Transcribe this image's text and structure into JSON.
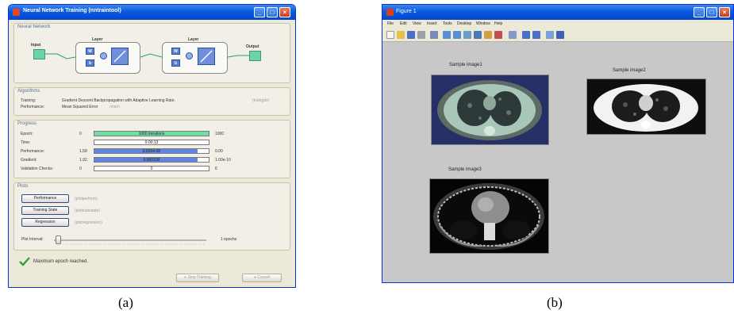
{
  "panel_a": {
    "caption": "(a)",
    "window_title": "Neural Network Training (nntraintool)",
    "neural_network": {
      "group_label": "Neural Network",
      "input_label": "Input",
      "output_label": "Output",
      "layer_label": "Layer",
      "w_label": "W",
      "b_label": "b"
    },
    "algorithms": {
      "group_label": "Algorithms",
      "rows": [
        {
          "label": "Training:",
          "value": "Gradient Descent Backpropagation with Adaptive Learning Rate.",
          "link": "(traingdx)"
        },
        {
          "label": "Performance:",
          "value": "Mean Squared Error",
          "link": "(mse)"
        }
      ]
    },
    "progress": {
      "group_label": "Progress",
      "rows": [
        {
          "label": "Epoch:",
          "start": "0",
          "bar_text": "1000 iterations",
          "end": "1000",
          "fraction": 1.0,
          "color": "#6ee0a4"
        },
        {
          "label": "Time:",
          "start": "",
          "bar_text": "0:00:13",
          "end": "",
          "fraction": 0.0,
          "color": "#6ee0a4"
        },
        {
          "label": "Performance:",
          "start": "1.58",
          "bar_text": "0.0264-05",
          "end": "0.00",
          "fraction": 0.9,
          "color": "#5f86e3"
        },
        {
          "label": "Gradient:",
          "start": "1.92",
          "bar_text": "0.000109",
          "end": "1.00e-10",
          "fraction": 0.9,
          "color": "#5f86e3"
        },
        {
          "label": "Validation Checks:",
          "start": "0",
          "bar_text": "0",
          "end": "6",
          "fraction": 0.0,
          "color": "#6ee0a4"
        }
      ]
    },
    "plots": {
      "group_label": "Plots",
      "buttons": [
        {
          "label": "Performance",
          "link": "(plotperform)"
        },
        {
          "label": "Training State",
          "link": "(plottrainstate)"
        },
        {
          "label": "Regression",
          "link": "(plotregression)"
        }
      ],
      "plot_interval_label": "Plot Interval:",
      "plot_interval_value": "1 epochs"
    },
    "status_text": "Maximum epoch reached.",
    "stop_training_label": "Stop Training",
    "cancel_label": "Cancel"
  },
  "panel_b": {
    "caption": "(b)",
    "window_title": "Figure 1",
    "menu": [
      "File",
      "Edit",
      "View",
      "Insert",
      "Tools",
      "Desktop",
      "Window",
      "Help"
    ],
    "images": [
      {
        "title": "Sample image1"
      },
      {
        "title": "Sample image2"
      },
      {
        "title": "Sample image3"
      }
    ]
  },
  "colors": {
    "xp_title_blue": "#0a5be0",
    "xp_face": "#ece9d8",
    "nn_green": "#6ed2a8",
    "nn_blue": "#5a7ed8",
    "figure_bg": "#c8c8c8"
  }
}
